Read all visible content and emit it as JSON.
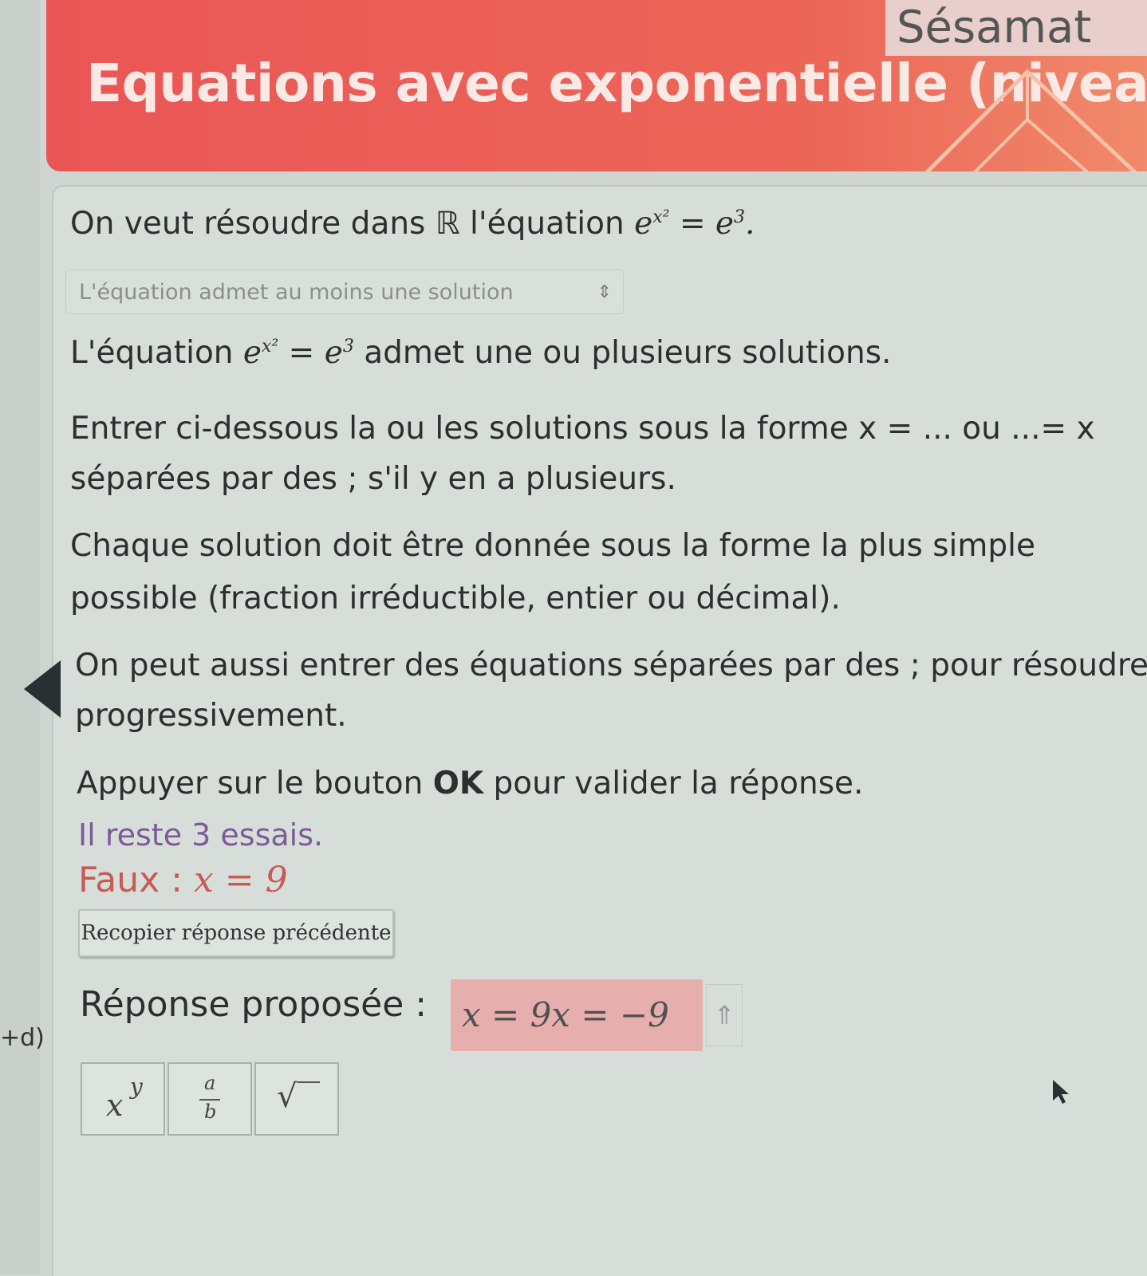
{
  "brand": "Sésamat",
  "header": {
    "title": "Equations avec exponentielle (niveau"
  },
  "intro": {
    "text": "On veut résoudre dans ℝ l'équation ",
    "equation": "e^{x²} = e³."
  },
  "select": {
    "value": "L'équation admet au moins une solution"
  },
  "statement": {
    "prefix": "L'équation ",
    "equation": "e^{x²} = e³",
    "suffix": " admet une ou plusieurs solutions."
  },
  "instructions": [
    "Entrer ci-dessous la ou les solutions sous la forme x = ... ou ...= x",
    "séparées par des ; s'il y en a plusieurs.",
    "Chaque solution doit être donnée sous la forme la plus simple",
    "possible (fraction irréductible, entier ou décimal).",
    "On peut aussi entrer des équations séparées par des ; pour résoudre",
    "progressivement."
  ],
  "ok_line": {
    "before": "Appuyer sur le bouton ",
    "bold": "OK",
    "after": " pour valider la réponse."
  },
  "tries": "Il reste 3 essais.",
  "faux": {
    "label": "Faux : ",
    "value": "x = 9"
  },
  "copy_button": "Recopier réponse précédente",
  "answer": {
    "label": "Réponse proposée : ",
    "value": "x = 9x = −9"
  },
  "side_label": "+d)",
  "keyboard": {
    "power": "x^y",
    "fraction": "a/b",
    "sqrt": "√"
  },
  "colors": {
    "header": "#ea5656",
    "error": "#c85a56",
    "tries": "#7d5a98",
    "answer_bg": "#e7aeae"
  }
}
